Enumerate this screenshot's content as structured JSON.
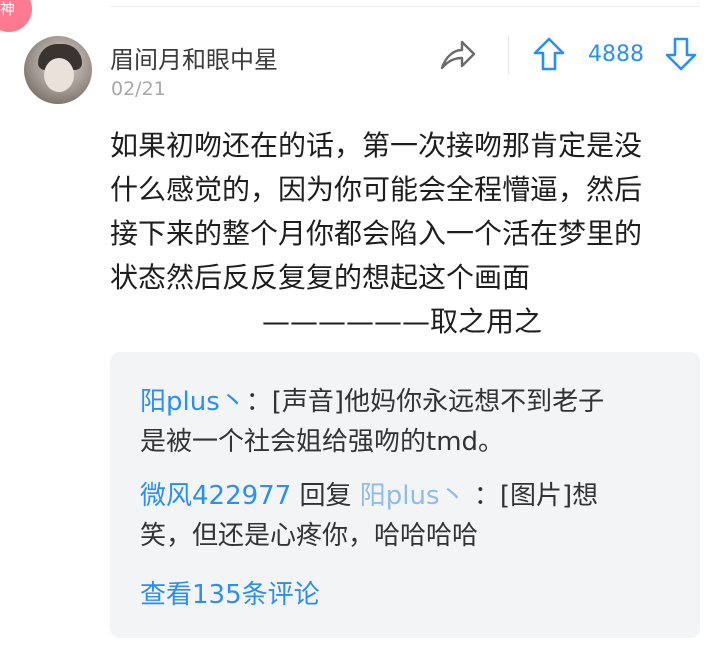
{
  "badge": {
    "text": "神",
    "color": "#ff7a8f"
  },
  "post": {
    "author": "眉间月和眼中星",
    "date": "02/21",
    "vote_count": "4888",
    "content_lines": [
      "如果初吻还在的话，第一次接吻那肯定是没",
      "什么感觉的，因为你可能会全程懵逼，然后",
      "接下来的整个月你都会陷入一个活在梦里的",
      "状态然后反反复复的想起这个画面"
    ],
    "signature": "——————取之用之"
  },
  "replies": [
    {
      "author": "阳plus丶",
      "separator": "：",
      "text_line1": "[声音]他妈你永远想不到老子",
      "text_line2": "是被一个社会姐给强吻的tmd。"
    },
    {
      "author": "微风422977",
      "reply_word": " 回复 ",
      "target": "阳plus丶",
      "separator": " ：",
      "text_line1": "[图片]想",
      "text_line2": "笑，但还是心疼你，哈哈哈哈"
    }
  ],
  "view_more": "查看135条评论",
  "icons": {
    "share": "share-icon",
    "up": "arrow-up-icon",
    "down": "arrow-down-icon"
  },
  "colors": {
    "accent": "#2b8ff0",
    "reply_bg": "#f3f4f6",
    "muted_link": "#8fbde8"
  }
}
